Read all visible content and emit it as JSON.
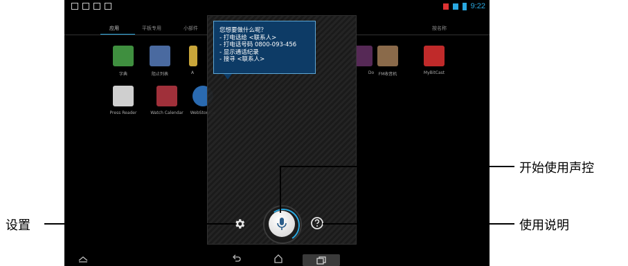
{
  "status_bar": {
    "time": "9:22"
  },
  "tabs": {
    "apps": "应用",
    "tablet": "平板专用",
    "widgets": "小部件",
    "sort": "按名称"
  },
  "apps": [
    {
      "label": "字典",
      "color": "#3f8f3f"
    },
    {
      "label": "阻止列表",
      "color": "#4a6aa0"
    },
    {
      "label": "A",
      "color": "#c9a63a"
    },
    {
      "label": "Do",
      "color": "#7a3a7a"
    },
    {
      "label": "FM收音机",
      "color": "#8a6a4a"
    },
    {
      "label": "MyBitCast",
      "color": "#c02a2a"
    },
    {
      "label": "Press Reader",
      "color": "#cfcfcf"
    },
    {
      "label": "Watch Calendar",
      "color": "#a0303a"
    },
    {
      "label": "WebStorage",
      "color": "#2a6ab0"
    }
  ],
  "voice_tooltip": {
    "lines": [
      "您想要做什么呢？",
      "- 打电话给 <联系人>",
      "- 打电话号码 0800-093-456",
      "- 显示通话纪录",
      "- 搜寻 <联系人>"
    ]
  },
  "callouts": {
    "start_voice": "开始使用声控",
    "settings": "设置",
    "help": "使用说明"
  },
  "colors": {
    "accent": "#2aa8e0",
    "tooltip_bg": "#0d3b66"
  }
}
